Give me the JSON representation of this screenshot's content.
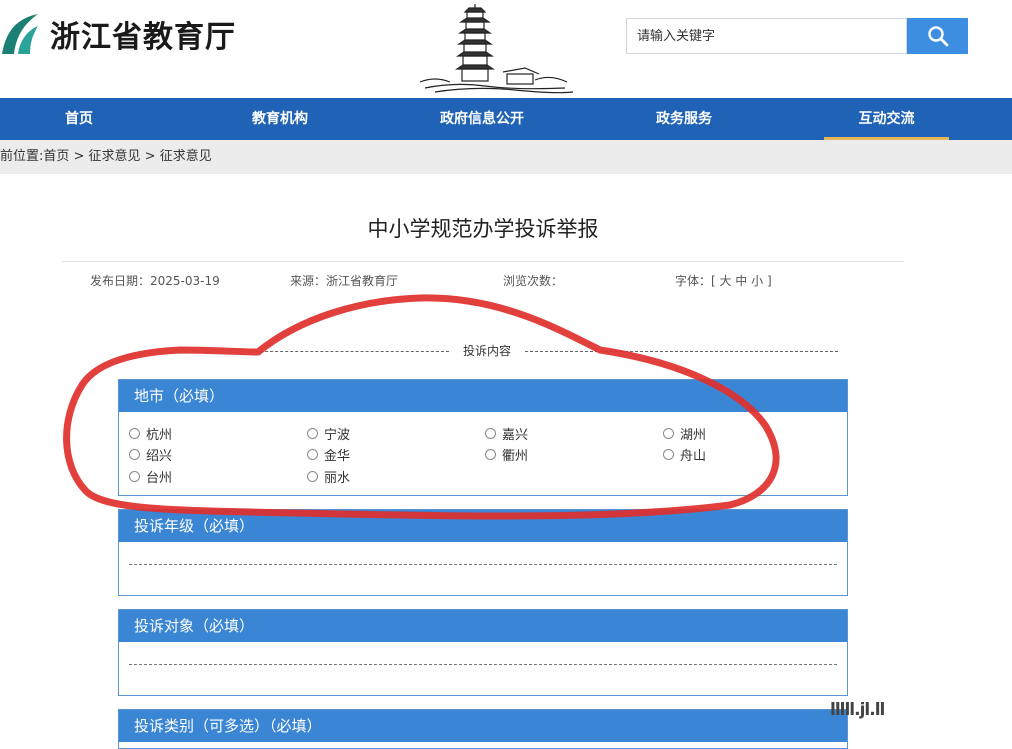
{
  "header": {
    "site_title": "浙江省教育厅",
    "search_placeholder": "请输入关键字",
    "search_icon": "search-icon"
  },
  "nav": {
    "items": [
      {
        "label": "首页",
        "active": false
      },
      {
        "label": "教育机构",
        "active": false
      },
      {
        "label": "政府信息公开",
        "active": false
      },
      {
        "label": "政务服务",
        "active": false
      },
      {
        "label": "互动交流",
        "active": true
      }
    ]
  },
  "breadcrumb": "前位置:首页 > 征求意见 > 征求意见",
  "article": {
    "title": "中小学规范办学投诉举报",
    "publish_date": "发布日期：2025-03-19",
    "source": "来源：浙江省教育厅",
    "views": "浏览次数：",
    "font_size": "字体：[ 大 中 小 ]"
  },
  "form": {
    "section_label": "投诉内容",
    "city": {
      "heading": "地市（必填）",
      "options": [
        "杭州",
        "宁波",
        "嘉兴",
        "湖州",
        "绍兴",
        "金华",
        "衢州",
        "舟山",
        "台州",
        "丽水"
      ]
    },
    "grade": {
      "heading": "投诉年级（必填）"
    },
    "target": {
      "heading": "投诉对象（必填）"
    },
    "category": {
      "heading": "投诉类别（可多选）（必填）"
    }
  },
  "watermark": "lllll.jl.ll",
  "colors": {
    "nav_bg": "#1f62b6",
    "panel_head": "#3a86d4",
    "search_button": "#3d8ee0",
    "annotation": "#e0302c",
    "active_underline": "#e6b85a"
  }
}
